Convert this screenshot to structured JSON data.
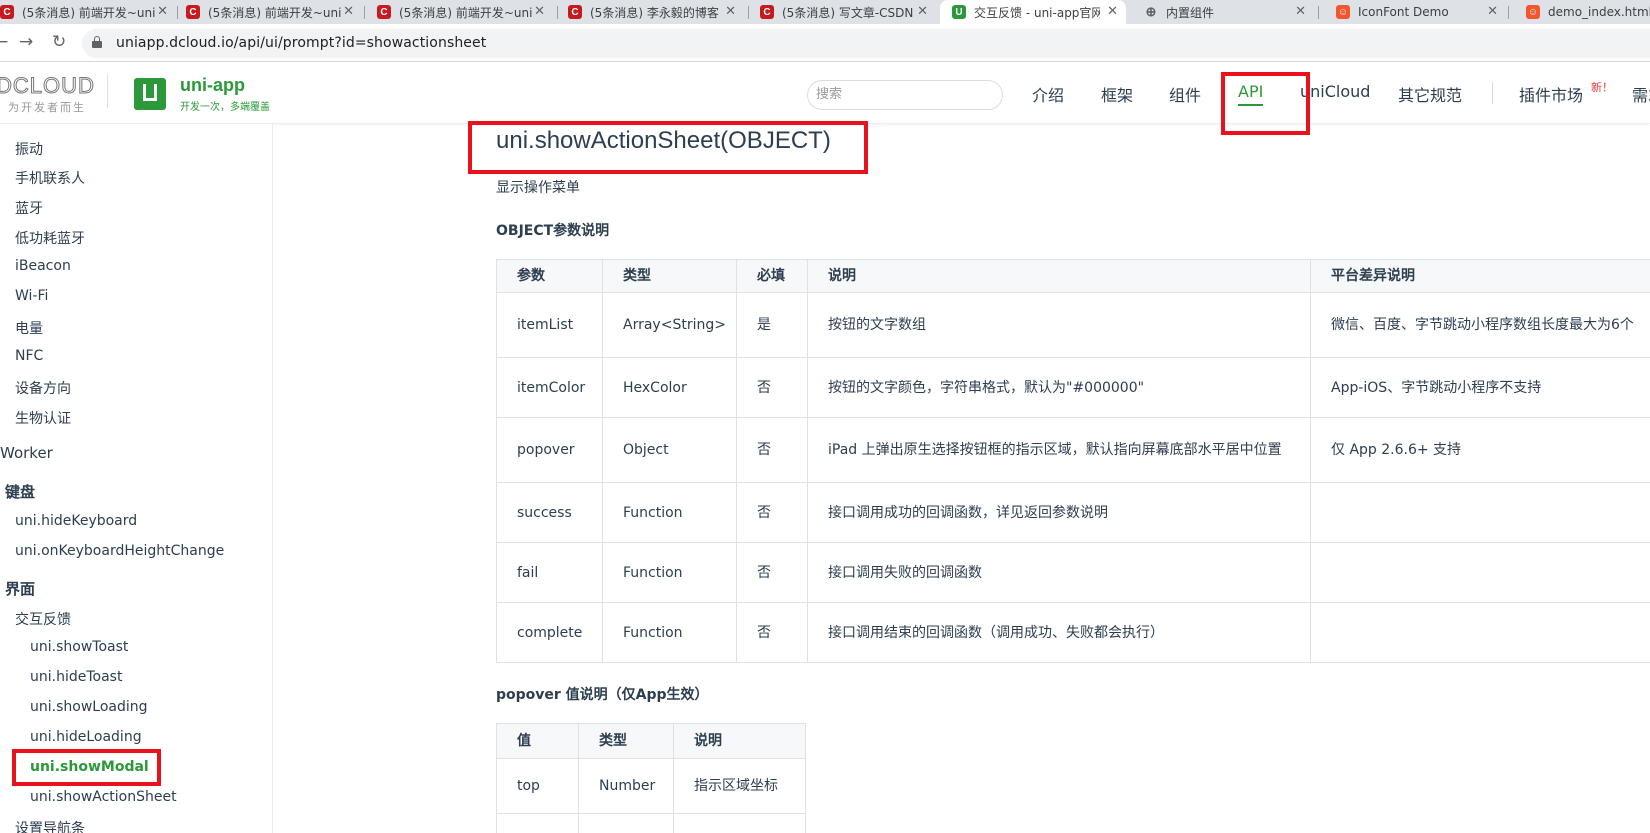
{
  "browser": {
    "tabs": [
      {
        "title": "(5条消息) 前端开发~uni",
        "favicon": "csdn-icon"
      },
      {
        "title": "(5条消息) 前端开发~uni",
        "favicon": "csdn-icon"
      },
      {
        "title": "(5条消息) 前端开发~uni",
        "favicon": "csdn-icon"
      },
      {
        "title": "(5条消息) 李永毅的博客",
        "favicon": "csdn-icon"
      },
      {
        "title": "(5条消息) 写文章-CSDN",
        "favicon": "csdn-icon"
      },
      {
        "title": "交互反馈 - uni-app官网",
        "favicon": "uni-app-icon"
      },
      {
        "title": "内置组件",
        "favicon": "globe-icon"
      },
      {
        "title": "IconFont Demo",
        "favicon": "iconfont-icon"
      },
      {
        "title": "demo_index.html",
        "favicon": "iconfont-icon"
      }
    ],
    "url": "uniapp.dcloud.io/api/ui/prompt?id=showactionsheet"
  },
  "header": {
    "dcloud_logo": "DCLOUD",
    "dcloud_slogan": "为开发者而生",
    "uni_name": "uni-app",
    "uni_slogan": "开发一次，多端覆盖",
    "search_placeholder": "搜索",
    "nav": [
      "介绍",
      "框架",
      "组件",
      "API",
      "uniCloud",
      "其它规范",
      "插件市场",
      "需求"
    ],
    "active_nav": "API",
    "new_badge": "新！"
  },
  "sidebar": {
    "items": [
      {
        "label": "振动"
      },
      {
        "label": "手机联系人"
      },
      {
        "label": "蓝牙"
      },
      {
        "label": "低功耗蓝牙"
      },
      {
        "label": "iBeacon"
      },
      {
        "label": "Wi-Fi"
      },
      {
        "label": "电量"
      },
      {
        "label": "NFC"
      },
      {
        "label": "设备方向"
      },
      {
        "label": "生物认证"
      },
      {
        "label": "Worker"
      },
      {
        "label": "键盘"
      },
      {
        "label": "uni.hideKeyboard"
      },
      {
        "label": "uni.onKeyboardHeightChange"
      },
      {
        "label": "界面"
      },
      {
        "label": "交互反馈"
      },
      {
        "label": "uni.showToast"
      },
      {
        "label": "uni.hideToast"
      },
      {
        "label": "uni.showLoading"
      },
      {
        "label": "uni.hideLoading"
      },
      {
        "label": "uni.showModal"
      },
      {
        "label": "uni.showActionSheet"
      },
      {
        "label": "设置导航条"
      }
    ],
    "active": "uni.showModal"
  },
  "content": {
    "title": "uni.showActionSheet(OBJECT)",
    "description": "显示操作菜单",
    "params_heading": "OBJECT参数说明",
    "params_table": {
      "headers": [
        "参数",
        "类型",
        "必填",
        "说明",
        "平台差异说明"
      ],
      "rows": [
        [
          "itemList",
          "Array<String>",
          "是",
          "按钮的文字数组",
          "微信、百度、字节跳动小程序数组长度最大为6个"
        ],
        [
          "itemColor",
          "HexColor",
          "否",
          "按钮的文字颜色，字符串格式，默认为\"#000000\"",
          "App-iOS、字节跳动小程序不支持"
        ],
        [
          "popover",
          "Object",
          "否",
          "iPad 上弹出原生选择按钮框的指示区域，默认指向屏幕底部水平居中位置",
          "仅 App 2.6.6+ 支持"
        ],
        [
          "success",
          "Function",
          "否",
          "接口调用成功的回调函数，详见返回参数说明",
          ""
        ],
        [
          "fail",
          "Function",
          "否",
          "接口调用失败的回调函数",
          ""
        ],
        [
          "complete",
          "Function",
          "否",
          "接口调用结束的回调函数（调用成功、失败都会执行）",
          ""
        ]
      ]
    },
    "popover_heading": "popover 值说明（仅App生效）",
    "popover_table": {
      "headers": [
        "值",
        "类型",
        "说明"
      ],
      "rows": [
        [
          "top",
          "Number",
          "指示区域坐标"
        ],
        [
          "",
          "",
          ""
        ]
      ]
    }
  },
  "colors": {
    "brand_green": "#2b9939",
    "annotation_red": "#e8111c"
  }
}
